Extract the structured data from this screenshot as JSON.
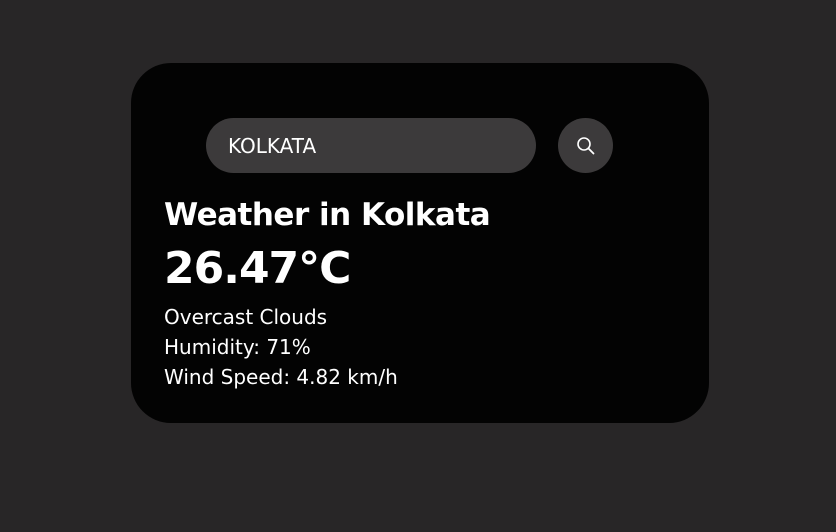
{
  "search": {
    "value": "KOLKATA",
    "icon": "search-icon"
  },
  "weather": {
    "title": "Weather in Kolkata",
    "temperature": "26.47°C",
    "description": "Overcast Clouds",
    "humidity": "Humidity: 71%",
    "wind": "Wind Speed: 4.82 km/h"
  },
  "colors": {
    "page_background": "#282627",
    "card_background": "#030303",
    "control_background": "#3c3a3b",
    "text": "#ffffff"
  }
}
